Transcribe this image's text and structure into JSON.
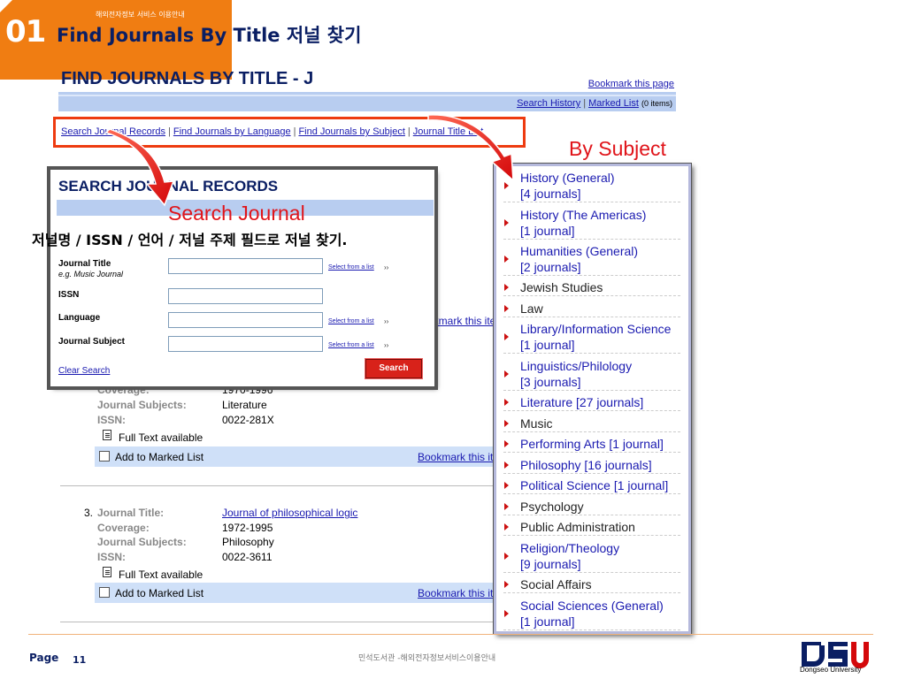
{
  "slide": {
    "section_number": "01",
    "section_small": "해외전자정보 서비스 이용안내",
    "title": "Find Journals By Title 저널 찾기"
  },
  "web": {
    "heading": "FIND JOURNALS BY TITLE - J",
    "bookmark_page": "Bookmark this page",
    "search_history": "Search History",
    "marked_list": "Marked List",
    "marked_count": "(0 items)",
    "nav": [
      "Search Journal Records",
      "Find Journals by Language",
      "Find Journals by Subject",
      "Journal Title List"
    ]
  },
  "callouts": {
    "by_subject": "By Subject",
    "search_journal": "Search Journal",
    "korean_caption": "저널명 / ISSN / 언어 / 저널 주제 필드로 저널 찾기."
  },
  "search_box": {
    "title": "SEARCH JOURNAL RECORDS",
    "fields": [
      {
        "label": "Journal Title",
        "hint": "e.g. Music Journal",
        "select": "Select from a list",
        "value": ""
      },
      {
        "label": "ISSN",
        "hint": "",
        "select": "",
        "value": ""
      },
      {
        "label": "Language",
        "hint": "",
        "select": "Select from a list",
        "value": ""
      },
      {
        "label": "Journal Subject",
        "hint": "",
        "select": "Select from a list",
        "value": ""
      }
    ],
    "arrows": "››",
    "clear": "Clear Search",
    "search_button": "Search"
  },
  "results": {
    "labels": {
      "title": "Journal Title:",
      "coverage": "Coverage:",
      "subjects": "Journal Subjects:",
      "issn": "ISSN:"
    },
    "full_text": "Full Text available",
    "add_marked": "Add to Marked List",
    "bookmark_item": "Bookmark this ite",
    "bookmark_item_partial": "okmark this ite",
    "items": [
      {
        "number": "",
        "title": "",
        "coverage": "1970-1996",
        "subjects": "Literature",
        "issn": "0022-281X"
      },
      {
        "number": "3.",
        "title": "Journal of philosophical logic",
        "coverage": "1972-1995",
        "subjects": "Philosophy",
        "issn": "0022-3611"
      }
    ]
  },
  "subjects": [
    {
      "line1": "History (General)",
      "line2": "[4 journals]",
      "link": true
    },
    {
      "line1": "History (The Americas)",
      "line2": "[1 journal]",
      "link": true
    },
    {
      "line1": "Humanities (General)",
      "line2": "[2 journals]",
      "link": true
    },
    {
      "line1": "Jewish Studies",
      "line2": "",
      "link": false
    },
    {
      "line1": "Law",
      "line2": "",
      "link": false
    },
    {
      "line1": "Library/Information Science",
      "line2": "[1 journal]",
      "link": true
    },
    {
      "line1": "Linguistics/Philology",
      "line2": "[3 journals]",
      "link": true
    },
    {
      "line1": "Literature [27 journals]",
      "line2": "",
      "link": true
    },
    {
      "line1": "Music",
      "line2": "",
      "link": false
    },
    {
      "line1": "Performing Arts [1 journal]",
      "line2": "",
      "link": true
    },
    {
      "line1": "Philosophy [16 journals]",
      "line2": "",
      "link": true
    },
    {
      "line1": "Political Science [1 journal]",
      "line2": "",
      "link": true
    },
    {
      "line1": "Psychology",
      "line2": "",
      "link": false
    },
    {
      "line1": "Public Administration",
      "line2": "",
      "link": false
    },
    {
      "line1": "Religion/Theology",
      "line2": "[9 journals]",
      "link": true
    },
    {
      "line1": "Social Affairs",
      "line2": "",
      "link": false
    },
    {
      "line1": "Social Sciences (General)",
      "line2": "[1 journal]",
      "link": true
    }
  ],
  "footer": {
    "page_label": "Page",
    "page_number": "11",
    "center": "민석도서관 -해외전자정보서비스이용안내",
    "logo_sub": "Dongseo University"
  },
  "colors": {
    "accent_orange": "#f07d12",
    "callout_red": "#e0141a",
    "link_blue": "#1a1ab0",
    "heading_navy": "#0a1e63"
  }
}
